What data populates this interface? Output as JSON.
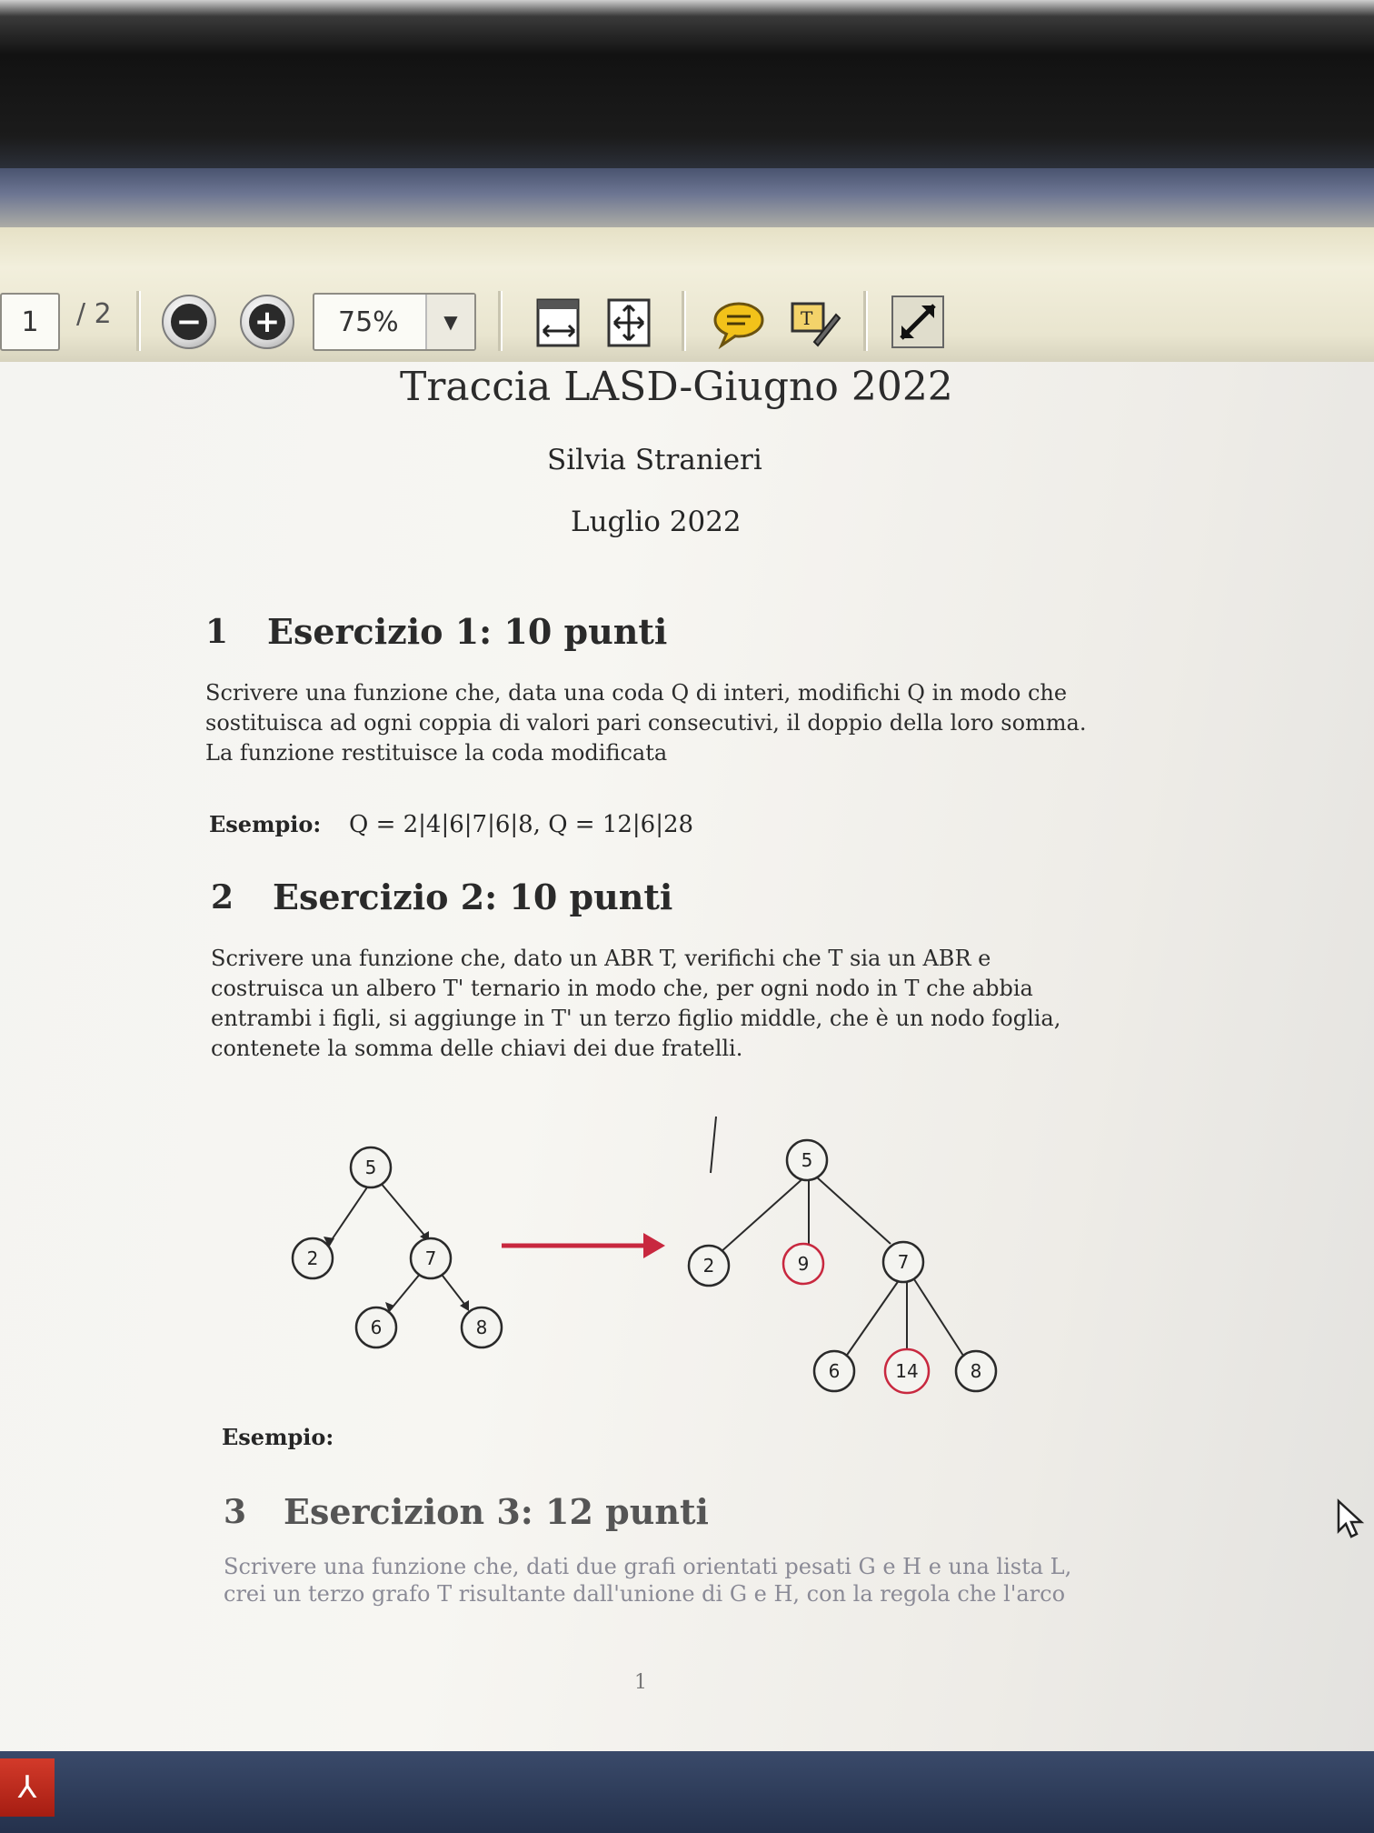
{
  "toolbar": {
    "page_current": "1",
    "page_total": "/ 2",
    "zoom_value": "75%"
  },
  "document": {
    "title": "Traccia LASD-Giugno 2022",
    "author": "Silvia Stranieri",
    "date": "Luglio 2022",
    "sections": [
      {
        "number": "1",
        "title": "Esercizio 1: 10 punti",
        "body": "Scrivere una funzione che, data una coda Q di interi, modifichi Q in modo che sostituisca ad ogni coppia di valori pari consecutivi, il doppio della loro somma. La funzione restituisce la coda modificata",
        "example_label": "Esempio:",
        "example_text": "Q = 2|4|6|7|6|8, Q = 12|6|28"
      },
      {
        "number": "2",
        "title": "Esercizio 2: 10 punti",
        "body": "Scrivere una funzione che, dato un ABR T, verifichi che T sia un ABR e costruisca un albero T' ternario in modo che, per ogni nodo in T che abbia entrambi i figli, si aggiunge in T' un terzo figlio middle, che è un nodo foglia, contenete la somma delle chiavi dei due fratelli.",
        "example_label": "Esempio:"
      },
      {
        "number": "3",
        "title": "Esercizion 3: 12 punti",
        "body": "Scrivere una funzione che, dati due grafi orientati pesati G e H e una lista L, crei un terzo grafo T risultante dall'unione di G e H, con la regola che l'arco"
      }
    ],
    "page_number": "1"
  },
  "diagram": {
    "left_tree": [
      "5",
      "2",
      "7",
      "6",
      "8"
    ],
    "right_tree": [
      "5",
      "2",
      "9",
      "7",
      "6",
      "14",
      "8"
    ],
    "highlight_color": "#c8283f"
  },
  "icons": {
    "zoom_out": "zoom-out-icon",
    "zoom_in": "zoom-in-icon",
    "fit_width": "fit-width-icon",
    "fit_page": "fit-page-icon",
    "comment": "comment-icon",
    "sign": "sign-icon",
    "fullscreen": "fullscreen-icon",
    "app": "acrobat-icon"
  }
}
